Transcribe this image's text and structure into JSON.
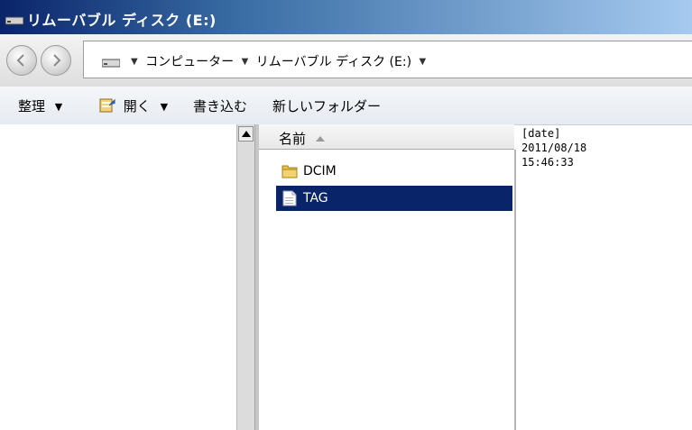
{
  "window": {
    "title": "リムーバブル ディスク (E:)"
  },
  "address_bar": {
    "crumbs": [
      "コンピューター",
      "リムーバブル ディスク (E:)"
    ]
  },
  "toolbar": {
    "organize": "整理",
    "open": "開く",
    "burn": "書き込む",
    "new_folder": "新しいフォルダー"
  },
  "columns": {
    "name": "名前"
  },
  "files": [
    {
      "name": "DCIM",
      "type": "folder",
      "selected": false
    },
    {
      "name": "TAG",
      "type": "file",
      "selected": true
    }
  ],
  "details": {
    "label": "[date]",
    "date": "2011/08/18",
    "time": "15:46:33"
  },
  "colors": {
    "selection": "#0a246a",
    "titlebar_start": "#0a246a",
    "titlebar_end": "#a6caf0",
    "folder": "#e8c04a"
  }
}
